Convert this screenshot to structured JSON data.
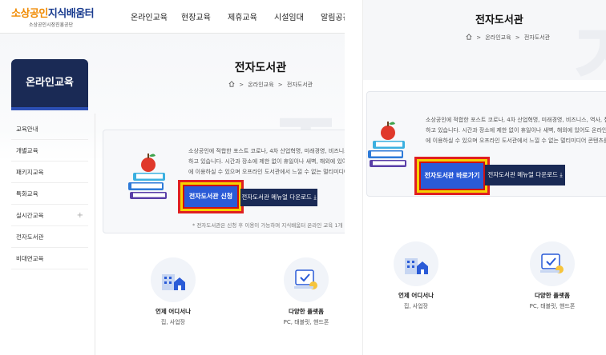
{
  "header": {
    "logo_main_a": "소상공인",
    "logo_main_b": "지식배움터",
    "logo_sub": "소상공인시장진흥공단",
    "nav": [
      "온라인교육",
      "현장교육",
      "제휴교육",
      "시설임대",
      "알림공간"
    ]
  },
  "sidebar": {
    "title": "온라인교육",
    "items": [
      {
        "label": "교육안내",
        "expandable": false
      },
      {
        "label": "개별교육",
        "expandable": false
      },
      {
        "label": "패키지교육",
        "expandable": false
      },
      {
        "label": "특화교육",
        "expandable": false
      },
      {
        "label": "실시간교육",
        "expandable": true
      },
      {
        "label": "전자도서관",
        "expandable": false
      },
      {
        "label": "비대면교육",
        "expandable": false
      }
    ],
    "plus_glyph": "+"
  },
  "page": {
    "title": "전자도서관",
    "breadcrumb": [
      "온라인교육",
      "전자도서관"
    ],
    "breadcrumb_sep": ">"
  },
  "left_card": {
    "desc_lines": [
      "소상공인에 적합한 포스트 코로나, 4차 산업혁명, 미래경영, 비즈니스, 역",
      "하고 있습니다. 시간과 장소에 제한 없이 휴일이나 새벽, 해외에 있어도 온",
      "에 이용하실 수 있으며 오프라인 도서관에서 느낄 수 없는 멀티미디어 콘"
    ],
    "primary_button": "전자도서관 신청",
    "manual_button": "전자도서관 메뉴얼 다운로드",
    "download_glyph": "⤓",
    "note": "* 전자도서관은 신청 후 이용이 가능하며 지식배움터 온라인 교육 1개 이상 수료 필"
  },
  "right_card": {
    "desc_lines": [
      "소상공인에 적합한 포스트 코로나, 4차 산업혁명, 미래경영, 비즈니스, 역사, 철학 등",
      "하고 있습니다. 시간과 장소에 제한 없이 휴일이나 새벽, 해외에 있어도 온라인(On-L",
      "에 이용하실 수 있으며 오프라인 도서관에서 느낄 수 없는 멀티미디어 콘텐츠를 통해"
    ],
    "primary_button": "전자도서관 바로가기",
    "manual_button": "전자도서관 메뉴얼 다운로드"
  },
  "features": [
    {
      "title": "언제 어디서나",
      "sub": "집, 사업장",
      "icon": "building-icon"
    },
    {
      "title": "다양한 플랫폼",
      "sub": "PC, 태블릿, 핸드폰",
      "icon": "device-icon"
    }
  ],
  "colors": {
    "navy": "#1a2a55",
    "primary_blue": "#2a5bd7",
    "highlight_red": "#e02020",
    "highlight_yellow": "#f6d200",
    "logo_orange": "#f08a00"
  }
}
